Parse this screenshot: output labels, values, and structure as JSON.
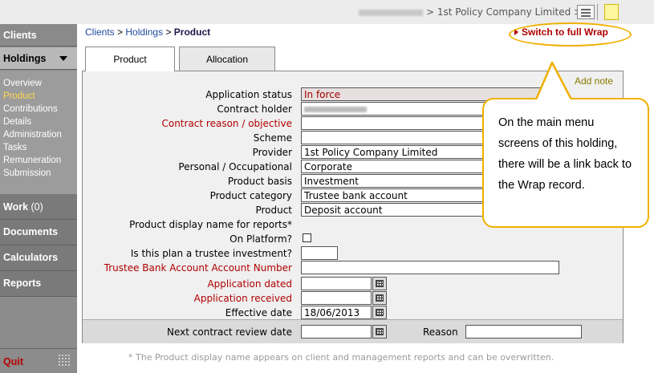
{
  "topbar": {
    "breadcrumb": "> 1st Policy Company Limited > >"
  },
  "sidebar": {
    "clients": "Clients",
    "holdings": "Holdings",
    "menu": [
      "Overview",
      "Product",
      "Contributions",
      "Details",
      "Administration",
      "Tasks",
      "Remuneration",
      "Submission"
    ],
    "active_item": "Product",
    "work": "Work",
    "work_count": "(0)",
    "documents": "Documents",
    "calculators": "Calculators",
    "reports": "Reports",
    "quit": "Quit"
  },
  "breadcrumb": {
    "clients": "Clients",
    "sep1": ">",
    "holdings": "Holdings",
    "sep2": ">",
    "current": "Product"
  },
  "switch_link": "Switch to full Wrap",
  "tabs": [
    "Product",
    "Allocation"
  ],
  "add_note": "Add note",
  "form": {
    "application_status": {
      "label": "Application status",
      "value": "In force"
    },
    "contract_holder": {
      "label": "Contract holder"
    },
    "contract_reason": {
      "label": "Contract reason / objective",
      "value": ""
    },
    "scheme": {
      "label": "Scheme",
      "value": ""
    },
    "provider": {
      "label": "Provider",
      "value": "1st Policy Company Limited"
    },
    "personal_occupational": {
      "label": "Personal / Occupational",
      "value": "Corporate"
    },
    "product_basis": {
      "label": "Product basis",
      "value": "Investment"
    },
    "product_category": {
      "label": "Product category",
      "value": "Trustee bank account"
    },
    "product": {
      "label": "Product",
      "value": "Deposit account"
    },
    "display_name": {
      "label": "Product display name for reports*"
    },
    "on_platform": {
      "label": "On Platform?"
    },
    "trustee_investment": {
      "label": "Is this plan a trustee investment?",
      "value": ""
    },
    "trustee_bank_account": {
      "label": "Trustee Bank Account Account Number",
      "value": ""
    },
    "application_dated": {
      "label": "Application dated",
      "value": ""
    },
    "application_received": {
      "label": "Application received",
      "value": ""
    },
    "effective_date": {
      "label": "Effective date",
      "value": "18/06/2013"
    },
    "next_review": {
      "label": "Next contract review date",
      "value": ""
    },
    "reason": {
      "label": "Reason",
      "value": ""
    }
  },
  "footnote": "* The Product display name appears on client and management reports and can be overwritten.",
  "callout": "On the main menu screens of this holding, there will be a link back to the Wrap record.",
  "colors": {
    "highlight": "#f0b000",
    "required_label": "#b00000",
    "link": "#1f4a9a"
  }
}
